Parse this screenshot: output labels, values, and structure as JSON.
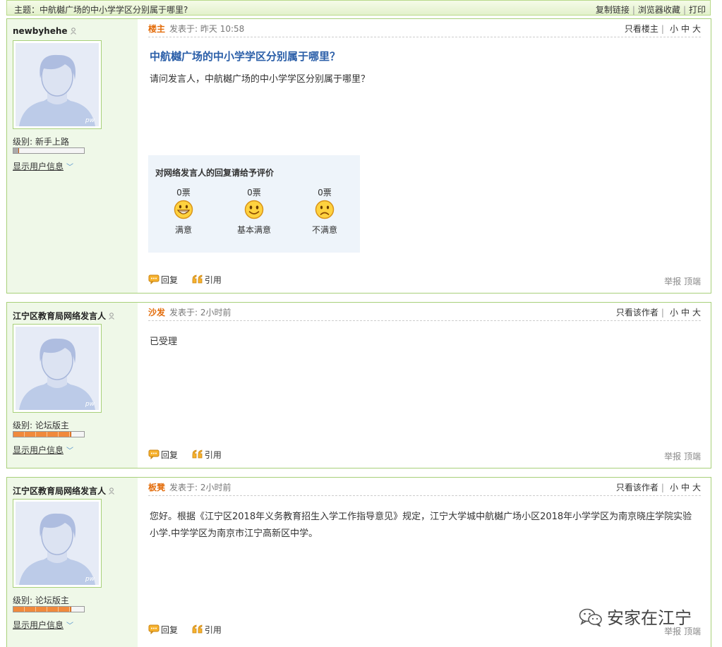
{
  "topbar": {
    "title": "主题：中航樾广场的中小学学区分别属于哪里?",
    "links": [
      "复制链接",
      "浏览器收藏",
      "打印"
    ]
  },
  "posts": [
    {
      "username": "newbyhehe",
      "avatar_mark": "pw",
      "level": "级别: 新手上路",
      "level_fill": 0.08,
      "show_info": "显示用户信息",
      "floor": "楼主",
      "time": "发表于: 昨天 10:58",
      "filter": "只看楼主",
      "sizes": [
        "小",
        "中",
        "大"
      ],
      "title": "中航樾广场的中小学学区分别属于哪里？",
      "content": "请问发言人，中航樾广场的中小学学区分别属于哪里？",
      "rating": {
        "title": "对网络发言人的回复请给予评价",
        "options": [
          {
            "votes": "0票",
            "label": "满意",
            "icon": "grin-face-icon"
          },
          {
            "votes": "0票",
            "label": "基本满意",
            "icon": "smile-face-icon"
          },
          {
            "votes": "0票",
            "label": "不满意",
            "icon": "sad-face-icon"
          }
        ]
      },
      "reply": "回复",
      "quote": "引用",
      "report": "举报",
      "top": "顶端"
    },
    {
      "username": "江宁区教育局网络发言人",
      "avatar_mark": "pw",
      "level": "级别: 论坛版主",
      "level_fill": 0.82,
      "show_info": "显示用户信息",
      "floor": "沙发",
      "time": "发表于: 2小时前",
      "filter": "只看该作者",
      "sizes": [
        "小",
        "中",
        "大"
      ],
      "content": "已受理",
      "reply": "回复",
      "quote": "引用",
      "report": "举报",
      "top": "顶端"
    },
    {
      "username": "江宁区教育局网络发言人",
      "avatar_mark": "pw",
      "level": "级别: 论坛版主",
      "level_fill": 0.82,
      "show_info": "显示用户信息",
      "floor": "板凳",
      "time": "发表于: 2小时前",
      "filter": "只看该作者",
      "sizes": [
        "小",
        "中",
        "大"
      ],
      "content": "您好。根据《江宁区2018年义务教育招生入学工作指导意见》规定，江宁大学城中航樾广场小区2018年小学学区为南京晓庄学院实验小学.中学学区为南京市江宁高新区中学。",
      "reply": "回复",
      "quote": "引用",
      "report": "举报",
      "top": "顶端"
    }
  ],
  "watermark": "安家在江宁",
  "colors": {
    "border": "#a8d07a",
    "sidebar_bg": "#eff8e8",
    "floor_orange": "#e36c0a",
    "title_blue": "#2a5ea8",
    "level_orange": "#f08a3c"
  }
}
